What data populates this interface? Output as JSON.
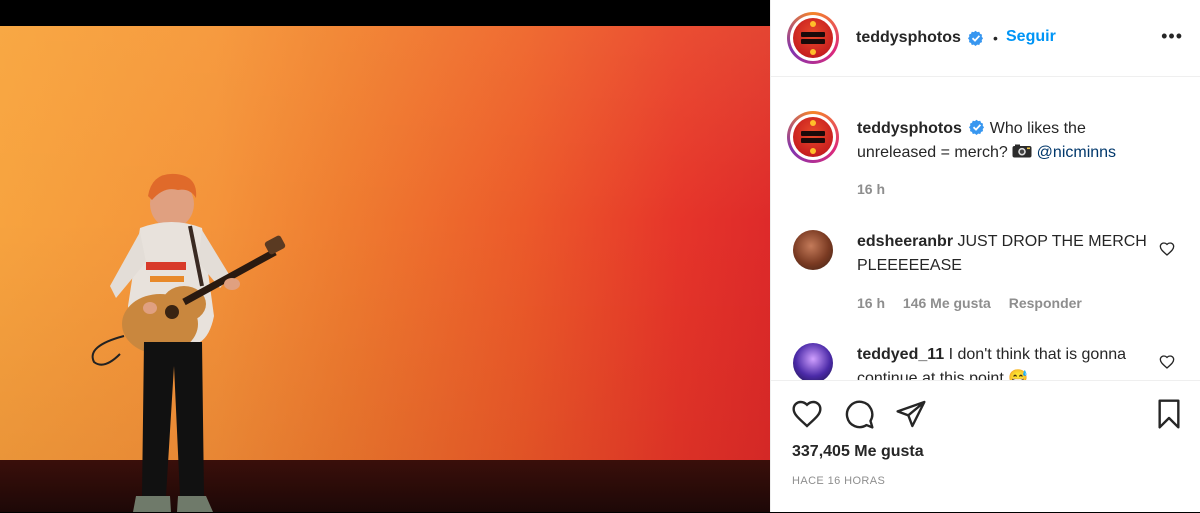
{
  "post": {
    "image_alt": "Guitarist on stage in front of an orange backdrop"
  },
  "header": {
    "username": "teddysphotos",
    "bullet": "•",
    "follow_label": "Seguir",
    "more_label": "•••"
  },
  "caption": {
    "username": "teddysphotos",
    "text_a": "Who likes the unreleased = merch?",
    "mention": "@nicminns",
    "time": "16 h"
  },
  "comments": [
    {
      "username": "edsheeranbr",
      "text": "JUST DROP THE MERCH PLEEEEEASE",
      "time": "16 h",
      "likes": "146 Me gusta",
      "reply_label": "Responder"
    },
    {
      "username": "teddyed_11",
      "text": "I don't think that is gonna continue at this point 😅"
    }
  ],
  "actions": {
    "likes": "337,405 Me gusta",
    "time_ago": "HACE 16 HORAS"
  },
  "colors": {
    "accent": "#0095f6",
    "mention": "#00376b",
    "muted": "#8e8e8e"
  },
  "icons": {
    "verified": "verified-badge-icon",
    "like": "heart-icon",
    "comment": "comment-bubble-icon",
    "share": "paper-plane-icon",
    "save": "bookmark-icon"
  }
}
